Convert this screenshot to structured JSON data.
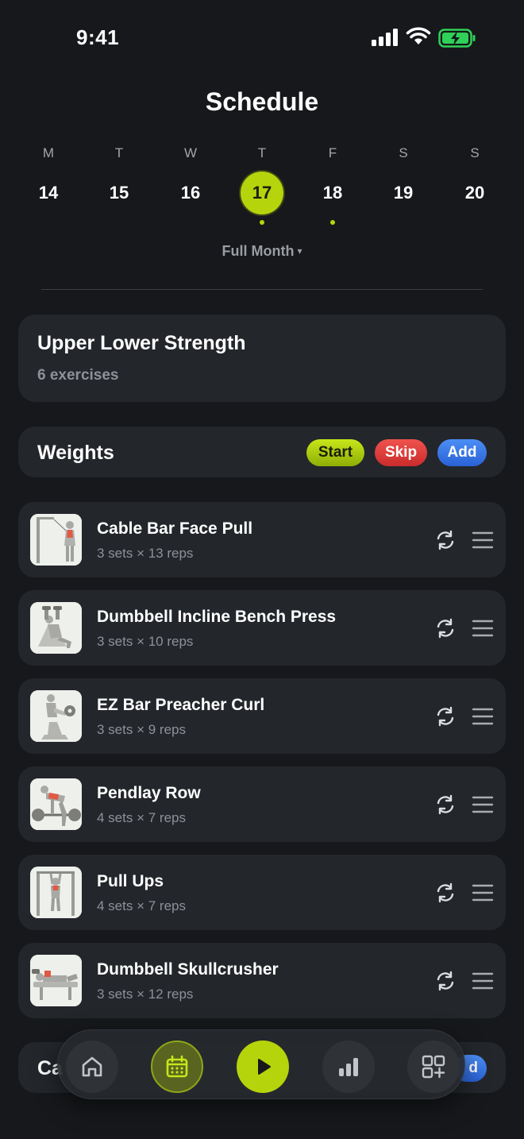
{
  "status_bar": {
    "time": "9:41"
  },
  "page_title": "Schedule",
  "week": [
    {
      "letter": "M",
      "date": "14",
      "selected": false,
      "has_workout": false
    },
    {
      "letter": "T",
      "date": "15",
      "selected": false,
      "has_workout": false
    },
    {
      "letter": "W",
      "date": "16",
      "selected": false,
      "has_workout": false
    },
    {
      "letter": "T",
      "date": "17",
      "selected": true,
      "has_workout": true
    },
    {
      "letter": "F",
      "date": "18",
      "selected": false,
      "has_workout": true
    },
    {
      "letter": "S",
      "date": "19",
      "selected": false,
      "has_workout": false
    },
    {
      "letter": "S",
      "date": "20",
      "selected": false,
      "has_workout": false
    }
  ],
  "month_toggle": {
    "label": "Full Month",
    "caret": "▾"
  },
  "workout": {
    "title": "Upper Lower Strength",
    "subtitle": "6 exercises"
  },
  "section": {
    "title": "Weights",
    "start_label": "Start",
    "skip_label": "Skip",
    "add_label": "Add"
  },
  "exercises": [
    {
      "name": "Cable Bar Face Pull",
      "sets": "3 sets × 13 reps",
      "icon": "face-pull-figure"
    },
    {
      "name": "Dumbbell Incline Bench Press",
      "sets": "3 sets × 10 reps",
      "icon": "incline-press-figure"
    },
    {
      "name": "EZ Bar Preacher Curl",
      "sets": "3 sets × 9 reps",
      "icon": "preacher-curl-figure"
    },
    {
      "name": "Pendlay Row",
      "sets": "4 sets × 7 reps",
      "icon": "row-figure"
    },
    {
      "name": "Pull Ups",
      "sets": "4 sets × 7 reps",
      "icon": "pull-up-figure"
    },
    {
      "name": "Dumbbell Skullcrusher",
      "sets": "3 sets × 12 reps",
      "icon": "skullcrusher-figure"
    }
  ],
  "peek_section": {
    "title_fragment": "Ca",
    "pill_fragment": "d"
  },
  "tabbar": [
    {
      "name": "home",
      "icon": "home-icon",
      "active": false
    },
    {
      "name": "calendar",
      "icon": "calendar-icon",
      "active": true
    },
    {
      "name": "play",
      "icon": "play-icon",
      "active": false
    },
    {
      "name": "stats",
      "icon": "bar-chart-icon",
      "active": false
    },
    {
      "name": "more",
      "icon": "grid-plus-icon",
      "active": false
    }
  ],
  "colors": {
    "background": "#16181b",
    "card": "#23262b",
    "accent": "#b6d40b",
    "skip": "#e0403d",
    "add": "#3b7ae6"
  }
}
